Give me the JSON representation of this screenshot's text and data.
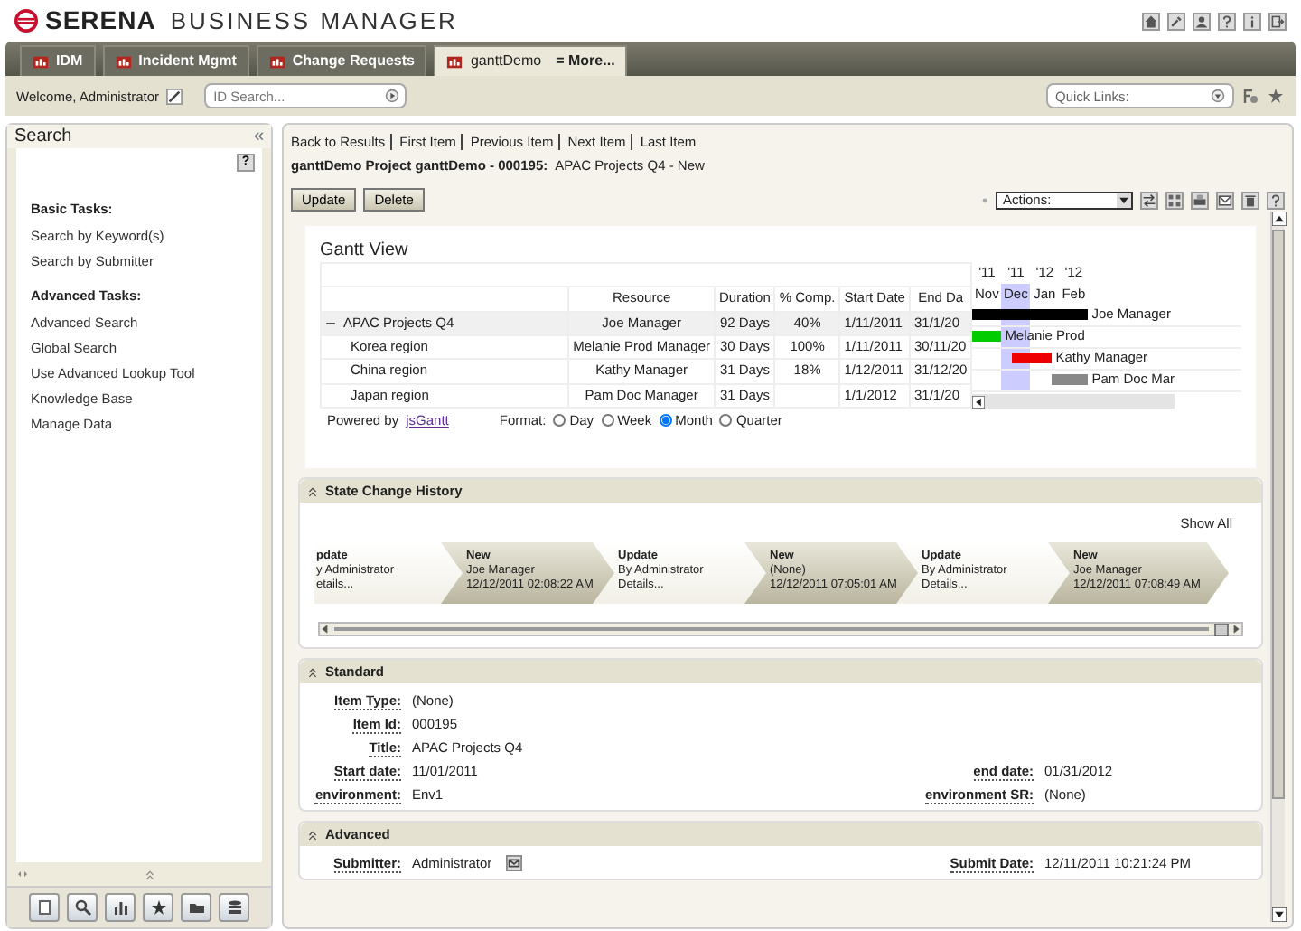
{
  "header": {
    "brand": "SERENA",
    "product": "BUSINESS MANAGER"
  },
  "tabs": [
    {
      "label": "IDM",
      "selected": false
    },
    {
      "label": "Incident Mgmt",
      "selected": false
    },
    {
      "label": "Change Requests",
      "selected": false
    },
    {
      "label": "ganttDemo",
      "selected": true
    }
  ],
  "more_tabs": "= More...",
  "toolbar": {
    "welcome": "Welcome, Administrator",
    "id_search": {
      "placeholder": "ID Search..."
    },
    "quick_links": {
      "placeholder": "Quick Links:"
    }
  },
  "search_panel": {
    "title": "Search",
    "collapse": "«",
    "help": "?",
    "sections": [
      {
        "heading": "Basic Tasks:",
        "links": [
          "Search by Keyword(s)",
          "Search by Submitter"
        ]
      },
      {
        "heading": "Advanced Tasks:",
        "links": [
          "Advanced Search",
          "Global Search",
          "Use Advanced Lookup Tool",
          "Knowledge Base",
          "Manage Data"
        ]
      }
    ]
  },
  "item": {
    "nav": [
      "Back to Results",
      "First Item",
      "Previous Item",
      "Next Item",
      "Last Item"
    ],
    "title": "ganttDemo Project ganttDemo - 000195:",
    "subtitle": "APAC Projects Q4 - New",
    "buttons": [
      "Update",
      "Delete"
    ],
    "actions": {
      "placeholder": "Actions:"
    }
  },
  "gantt": {
    "title": "Gantt View",
    "columns": [
      "Resource",
      "Duration",
      "% Comp.",
      "Start Date",
      "End Da"
    ],
    "years": [
      "'11",
      "'11",
      "'12",
      "'12"
    ],
    "months": [
      {
        "label": "Nov",
        "selected": false
      },
      {
        "label": "Dec",
        "selected": true
      },
      {
        "label": "Jan",
        "selected": false
      },
      {
        "label": "Feb",
        "selected": false
      }
    ],
    "rows": [
      {
        "name": "APAC Projects Q4",
        "expanded": true,
        "resource": "Joe Manager",
        "duration": "92 Days",
        "complete": "40%",
        "start": "1/11/2011",
        "end": "31/1/20",
        "bar_label": "Joe Manager",
        "color": "#000000",
        "children": [
          {
            "name": "Korea region",
            "resource": "Melanie Prod Manager",
            "duration": "30 Days",
            "complete": "100%",
            "start": "1/11/2011",
            "end": "30/11/20",
            "bar_label": "Melanie Prod",
            "color": "#00cc00"
          },
          {
            "name": "China region",
            "resource": "Kathy Manager",
            "duration": "31 Days",
            "complete": "18%",
            "start": "1/12/2011",
            "end": "31/12/20",
            "bar_label": "Kathy Manager",
            "color": "#ee0000"
          },
          {
            "name": "Japan region",
            "resource": "Pam Doc Manager",
            "duration": "31 Days",
            "start": "1/1/2012",
            "end": "31/1/20",
            "bar_label": "Pam Doc Mar",
            "color": "#888888"
          }
        ]
      }
    ],
    "powered_by": "Powered by",
    "link": "jsGantt",
    "format_label": "Format:",
    "formats": [
      {
        "label": "Day",
        "selected": false
      },
      {
        "label": "Week",
        "selected": false
      },
      {
        "label": "Month",
        "selected": true
      },
      {
        "label": "Quarter",
        "selected": false
      }
    ]
  },
  "history": {
    "title": "State Change History",
    "show_all": "Show All",
    "steps": [
      {
        "kind": "transition",
        "title": "pdate",
        "lines": [
          "y Administrator",
          "etails..."
        ]
      },
      {
        "kind": "state",
        "title": "New",
        "lines": [
          "Joe Manager",
          "12/12/2011 02:08:22 AM"
        ]
      },
      {
        "kind": "transition",
        "title": "Update",
        "lines": [
          "By Administrator",
          "Details..."
        ]
      },
      {
        "kind": "state",
        "title": "New",
        "lines": [
          "(None)",
          "12/12/2011 07:05:01 AM"
        ]
      },
      {
        "kind": "transition",
        "title": "Update",
        "lines": [
          "By Administrator",
          "Details..."
        ]
      },
      {
        "kind": "state",
        "title": "New",
        "lines": [
          "Joe Manager",
          "12/12/2011 07:08:49 AM"
        ]
      }
    ]
  },
  "sections": [
    {
      "title": "Standard",
      "rows": [
        {
          "left": {
            "label": "Item Type:",
            "value": "(None)"
          }
        },
        {
          "left": {
            "label": "Item Id:",
            "value": "000195"
          }
        },
        {
          "left": {
            "label": "Title:",
            "value": "APAC Projects Q4"
          }
        },
        {
          "left": {
            "label": "Start date:",
            "value": "11/01/2011"
          },
          "right": {
            "label": "end date:",
            "value": "01/31/2012"
          }
        },
        {
          "left": {
            "label": "environment:",
            "value": "Env1"
          },
          "right": {
            "label": "environment SR:",
            "value": "(None)"
          }
        }
      ]
    },
    {
      "title": "Advanced",
      "rows": [
        {
          "left": {
            "label": "Submitter:",
            "value": "Administrator",
            "kind": "user"
          },
          "right": {
            "label": "Submit Date:",
            "value": "12/11/2011 10:21:24 PM"
          }
        }
      ]
    }
  ]
}
